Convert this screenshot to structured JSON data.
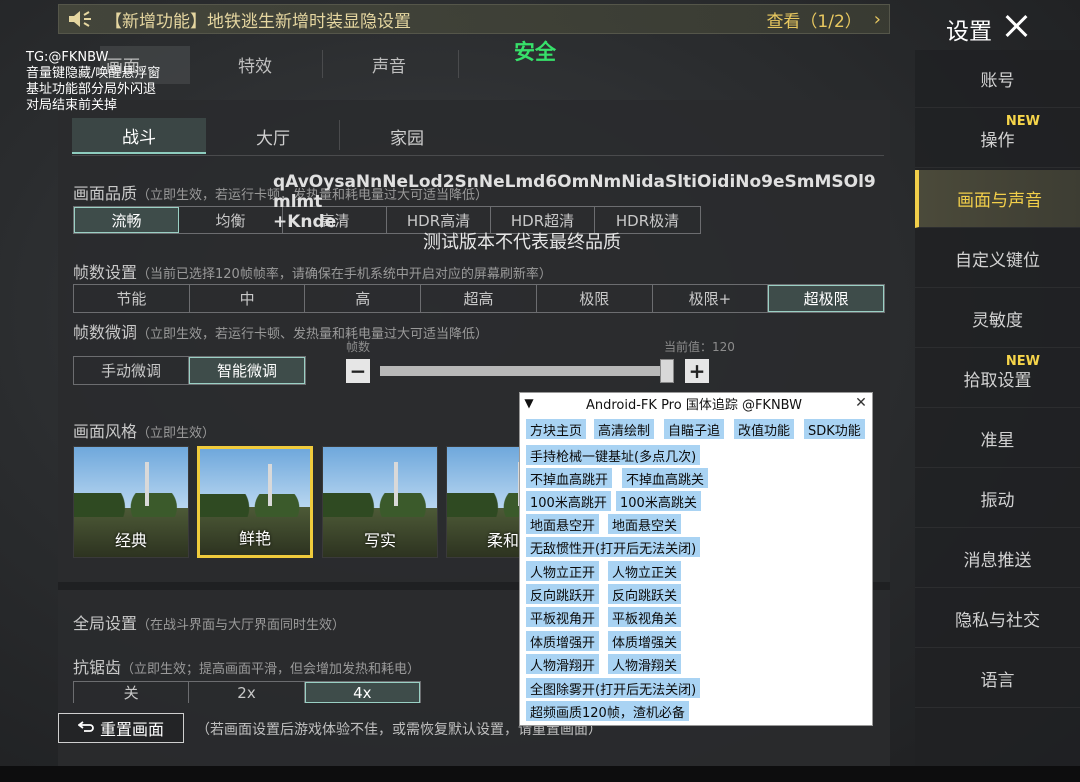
{
  "announcement": {
    "title": "【新增功能】地铁逃生新增时装显隐设置",
    "view_label": "查看（1/2）",
    "chevron": "›"
  },
  "header": {
    "settings_title": "设置"
  },
  "sidebar": {
    "items": [
      {
        "label": "账号",
        "new": ""
      },
      {
        "label": "操作",
        "new": "NEW"
      },
      {
        "label": "画面与声音",
        "new": ""
      },
      {
        "label": "自定义键位",
        "new": ""
      },
      {
        "label": "灵敏度",
        "new": ""
      },
      {
        "label": "拾取设置",
        "new": "NEW"
      },
      {
        "label": "准星",
        "new": ""
      },
      {
        "label": "振动",
        "new": ""
      },
      {
        "label": "消息推送",
        "new": ""
      },
      {
        "label": "隐私与社交",
        "new": ""
      },
      {
        "label": "语言",
        "new": ""
      }
    ],
    "active_index": 2
  },
  "top_tabs": [
    "画面",
    "特效",
    "声音",
    "安全"
  ],
  "sub_tabs": [
    "战斗",
    "大厅",
    "家园"
  ],
  "overlay": {
    "watermark": [
      "TG:@FKNBW",
      "音量键隐藏/唤醒悬浮窗",
      "基址功能部分局外闪退",
      "对局结束前关掉"
    ],
    "code_lines": [
      "qAvOysaNnNeLod2SnNeLmd6OmNmNidaSltiOidiNo9eSmMSOl9",
      "mlmt",
      "+Knde"
    ],
    "test_version": "测试版本不代表最终品质"
  },
  "quality": {
    "label": "画面品质",
    "hint": "（立即生效，若运行卡顿，发热量和耗电量过大可适当降低）",
    "options": [
      "流畅",
      "均衡",
      "高清",
      "HDR高清",
      "HDR超清",
      "HDR极清"
    ],
    "selected": "流畅"
  },
  "framerate": {
    "label": "帧数设置",
    "hint": "（当前已选择120帧帧率，请确保在手机系统中开启对应的屏幕刷新率）",
    "options": [
      "节能",
      "中",
      "高",
      "超高",
      "极限",
      "极限+",
      "超极限"
    ],
    "selected": "超极限"
  },
  "fine_tune": {
    "label": "帧数微调",
    "hint": "（立即生效，若运行卡顿、发热量和耗电量过大可适当降低）",
    "modes": [
      "手动微调",
      "智能微调"
    ],
    "selected": "智能微调",
    "slider_label": "帧数",
    "current_label": "当前值：120",
    "minus": "−",
    "plus": "+",
    "value_fraction": 0.99
  },
  "style": {
    "label": "画面风格",
    "hint": "（立即生效）",
    "cards": [
      "经典",
      "鲜艳",
      "写实",
      "柔和"
    ],
    "selected": "鲜艳"
  },
  "global": {
    "label": "全局设置",
    "hint": "（在战斗界面与大厅界面同时生效）",
    "aa_label": "抗锯齿",
    "aa_hint": "（立即生效；提高画面平滑，但会增加发热和耗电）",
    "aa_options": [
      "关",
      "2x",
      "4x"
    ],
    "aa_selected": "4x"
  },
  "reset": {
    "label": "重置画面",
    "hint": "（若画面设置后游戏体验不佳，或需恢复默认设置，请重置画面）"
  },
  "fk_menu": {
    "title": "Android-FK Pro 国体追踪 @FKNBW",
    "triangle": "▼",
    "close": "✕",
    "tabs": [
      "方块主页",
      "高清绘制",
      "自瞄子追",
      "改值功能",
      "SDK功能"
    ],
    "buttons": [
      [
        "手持枪械一键基址(多点几次)"
      ],
      [
        "不掉血高跳开",
        "不掉血高跳关"
      ],
      [
        "100米高跳开",
        "100米高跳关"
      ],
      [
        "地面悬空开",
        "地面悬空关"
      ],
      [
        "无敌惯性开(打开后无法关闭)"
      ],
      [
        "人物立正开",
        "人物立正关"
      ],
      [
        "反向跳跃开",
        "反向跳跃关"
      ],
      [
        "平板视角开",
        "平板视角关"
      ],
      [
        "体质增强开",
        "体质增强关"
      ],
      [
        "人物滑翔开",
        "人物滑翔关"
      ],
      [
        "全图除雾开(打开后无法关闭)"
      ],
      [
        "超频画质120帧，渣机必备"
      ]
    ]
  },
  "colors": {
    "accent_gold": "#f2cf4a",
    "safe_green": "#37e06a",
    "menu_button": "#a9d3f3"
  }
}
